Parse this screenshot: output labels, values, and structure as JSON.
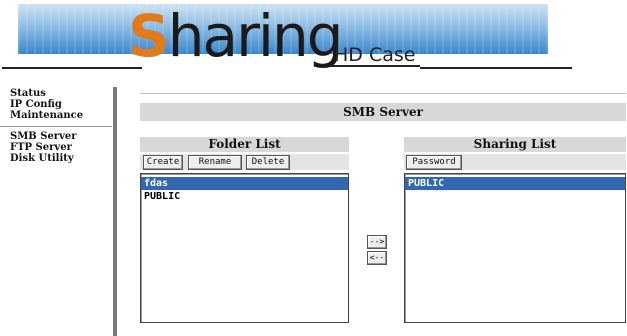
{
  "header": {
    "logo_initial": "S",
    "logo_rest": "haring",
    "subtitle": "HD Case"
  },
  "nav": {
    "group1": [
      "Status",
      "IP Config",
      "Maintenance"
    ],
    "group2": [
      "SMB Server",
      "FTP Server",
      "Disk Utility"
    ]
  },
  "page": {
    "title": "SMB Server"
  },
  "folder_list": {
    "title": "Folder List",
    "buttons": {
      "create": "Create",
      "rename": "Rename",
      "delete": "Delete"
    },
    "items": [
      "fdas",
      "PUBLIC"
    ],
    "selected": "fdas"
  },
  "sharing_list": {
    "title": "Sharing List",
    "buttons": {
      "password": "Password"
    },
    "items": [
      "PUBLIC"
    ],
    "selected": "PUBLIC"
  },
  "transfer": {
    "add": "-->",
    "remove": "<--"
  },
  "colors": {
    "selection": "#3268b0",
    "logo_accent": "#e07a1a",
    "header_bg": "#d8d8d8"
  }
}
